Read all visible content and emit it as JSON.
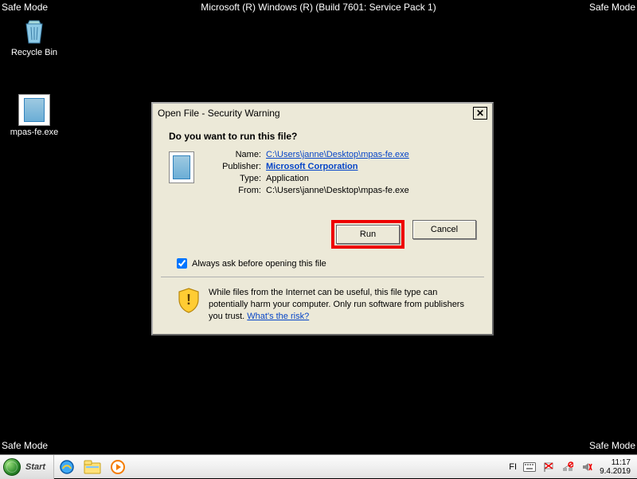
{
  "corners": {
    "tl": "Safe Mode",
    "tr": "Safe Mode",
    "bl": "Safe Mode",
    "br": "Safe Mode",
    "build": "Microsoft (R) Windows (R) (Build 7601: Service Pack 1)"
  },
  "desktop": {
    "recycle": "Recycle Bin",
    "file": "mpas-fe.exe"
  },
  "dialog": {
    "title": "Open File - Security Warning",
    "question": "Do you want to run this file?",
    "labels": {
      "name": "Name:",
      "publisher": "Publisher:",
      "type_lbl": "Type:",
      "from": "From:"
    },
    "values": {
      "name": "C:\\Users\\janne\\Desktop\\mpas-fe.exe",
      "publisher": "Microsoft Corporation",
      "type": "Application",
      "from": "C:\\Users\\janne\\Desktop\\mpas-fe.exe"
    },
    "buttons": {
      "run": "Run",
      "cancel": "Cancel"
    },
    "always_ask": "Always ask before opening this file",
    "warning": "While files from the Internet can be useful, this file type can potentially harm your computer. Only run software from publishers you trust. ",
    "risk_link": "What's the risk?"
  },
  "taskbar": {
    "start": "Start",
    "lang": "FI",
    "time": "11:17",
    "date": "9.4.2019"
  }
}
